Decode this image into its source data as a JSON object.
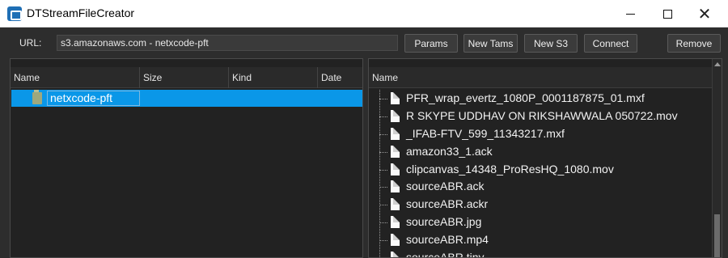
{
  "window": {
    "title": "DTStreamFileCreator"
  },
  "toolbar": {
    "url_label": "URL:",
    "url_value": "s3.amazonaws.com - netxcode-pft",
    "buttons": {
      "params": "Params",
      "new_tams": "New Tams",
      "new_s3": "New S3",
      "connect": "Connect",
      "remove": "Remove"
    }
  },
  "left_pane": {
    "columns": [
      "Name",
      "Size",
      "Kind",
      "Date"
    ],
    "bucket": "netxcode-pft"
  },
  "right_pane": {
    "column": "Name",
    "files": [
      "PFR_wrap_evertz_1080P_0001187875_01.mxf",
      "R SKYPE UDDHAV ON RIKSHAWWALA 050722.mov",
      "_IFAB-FTV_599_11343217.mxf",
      "amazon33_1.ack",
      "clipcanvas_14348_ProResHQ_1080.mov",
      "sourceABR.ack",
      "sourceABR.ackr",
      "sourceABR.jpg",
      "sourceABR.mp4",
      "sourceABR.tiny"
    ]
  },
  "colors": {
    "selection": "#0a97e8",
    "background": "#2d2d2d"
  }
}
